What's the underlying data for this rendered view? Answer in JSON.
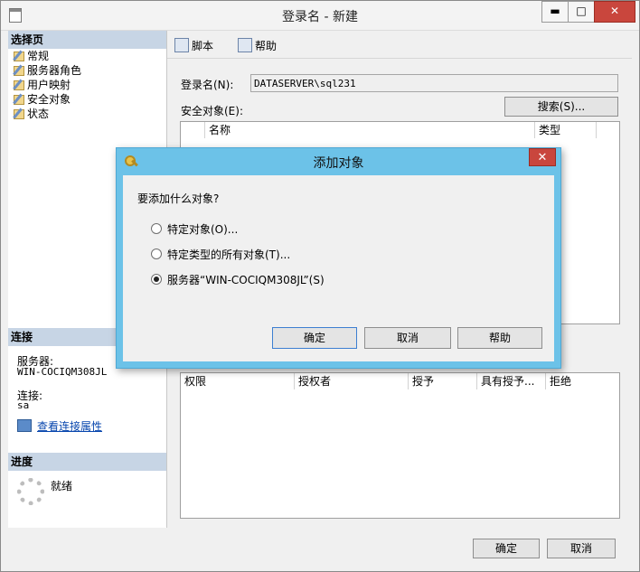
{
  "window": {
    "title": "登录名 - 新建",
    "minimize": "▬",
    "maximize": "□",
    "close": "✕"
  },
  "sidebar": {
    "select_page_header": "选择页",
    "pages": [
      "常规",
      "服务器角色",
      "用户映射",
      "安全对象",
      "状态"
    ],
    "connection_header": "连接",
    "server_label": "服务器:",
    "server_value": "WIN-COCIQM308JL",
    "connection_label": "连接:",
    "connection_value": "sa",
    "view_connection_link": "查看连接属性",
    "progress_header": "进度",
    "progress_status": "就绪"
  },
  "toolbar": {
    "script_label": "脚本",
    "help_label": "帮助"
  },
  "main": {
    "login_name_label": "登录名(N):",
    "login_name_value": "DATASERVER\\sql231",
    "securables_label": "安全对象(E):",
    "search_button": "搜索(S)...",
    "securables_columns": [
      "名称",
      "类型"
    ],
    "permissions_columns": [
      "权限",
      "授权者",
      "授予",
      "具有授予...",
      "拒绝"
    ]
  },
  "bottom": {
    "ok_button": "确定",
    "cancel_button": "取消"
  },
  "dialog": {
    "title": "添加对象",
    "close": "✕",
    "question": "要添加什么对象?",
    "options": [
      {
        "label": "特定对象(O)...",
        "checked": false
      },
      {
        "label": "特定类型的所有对象(T)...",
        "checked": false
      },
      {
        "label": "服务器“WIN-COCIQM308JL”(S)",
        "checked": true
      }
    ],
    "ok_button": "确定",
    "cancel_button": "取消",
    "help_button": "帮助"
  }
}
